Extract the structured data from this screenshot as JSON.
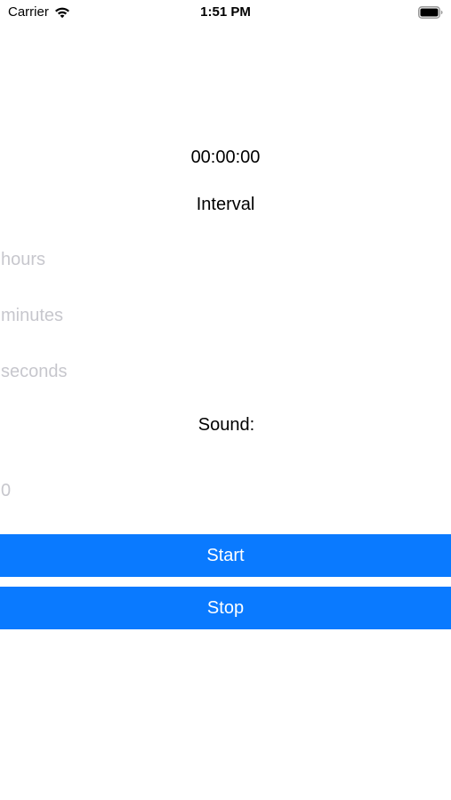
{
  "status_bar": {
    "carrier": "Carrier",
    "time": "1:51 PM",
    "wifi_icon": "wifi-icon",
    "battery_icon": "battery-icon"
  },
  "timer": {
    "display": "00:00:00",
    "interval_label": "Interval"
  },
  "fields": {
    "hours_placeholder": "hours",
    "minutes_placeholder": "minutes",
    "seconds_placeholder": "seconds",
    "sound_placeholder": "0"
  },
  "sound": {
    "label": "Sound:"
  },
  "buttons": {
    "start_label": "Start",
    "stop_label": "Stop"
  },
  "colors": {
    "accent": "#0a7aff",
    "placeholder": "#c7c7cd",
    "background": "#ffffff"
  }
}
